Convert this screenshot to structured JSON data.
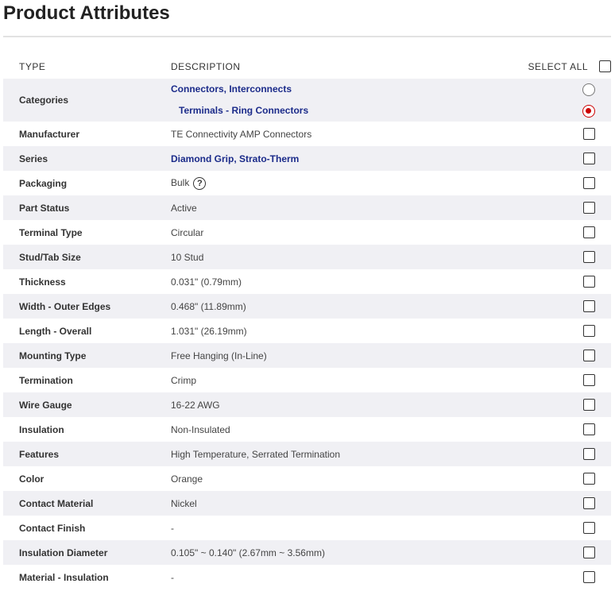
{
  "page": {
    "title": "Product Attributes"
  },
  "table": {
    "headers": {
      "type": "TYPE",
      "description": "DESCRIPTION",
      "select_all": "SELECT ALL"
    },
    "categories": {
      "type": "Categories",
      "items": [
        {
          "label": "Connectors, Interconnects",
          "selected": false
        },
        {
          "label": "Terminals - Ring Connectors",
          "selected": true
        }
      ]
    },
    "rows": [
      {
        "type": "Manufacturer",
        "value": "TE Connectivity AMP Connectors"
      },
      {
        "type": "Series",
        "value": "Diamond Grip, Strato-Therm",
        "link": true
      },
      {
        "type": "Packaging",
        "value": "Bulk",
        "help_icon": "question-circle-icon",
        "help_glyph": "?"
      },
      {
        "type": "Part Status",
        "value": "Active"
      },
      {
        "type": "Terminal Type",
        "value": "Circular"
      },
      {
        "type": "Stud/Tab Size",
        "value": "10 Stud"
      },
      {
        "type": "Thickness",
        "value": "0.031\" (0.79mm)"
      },
      {
        "type": "Width - Outer Edges",
        "value": "0.468\" (11.89mm)"
      },
      {
        "type": "Length - Overall",
        "value": "1.031\" (26.19mm)"
      },
      {
        "type": "Mounting Type",
        "value": "Free Hanging (In-Line)"
      },
      {
        "type": "Termination",
        "value": "Crimp"
      },
      {
        "type": "Wire Gauge",
        "value": "16-22 AWG"
      },
      {
        "type": "Insulation",
        "value": "Non-Insulated"
      },
      {
        "type": "Features",
        "value": "High Temperature, Serrated Termination"
      },
      {
        "type": "Color",
        "value": "Orange"
      },
      {
        "type": "Contact Material",
        "value": "Nickel"
      },
      {
        "type": "Contact Finish",
        "value": "-"
      },
      {
        "type": "Insulation Diameter",
        "value": "0.105\" ~ 0.140\" (2.67mm ~ 3.56mm)"
      },
      {
        "type": "Material - Insulation",
        "value": "-"
      }
    ]
  },
  "colors": {
    "accent_link": "#1b2b8a",
    "radio_selected": "#cc0000",
    "row_shade": "#f0f0f4"
  }
}
